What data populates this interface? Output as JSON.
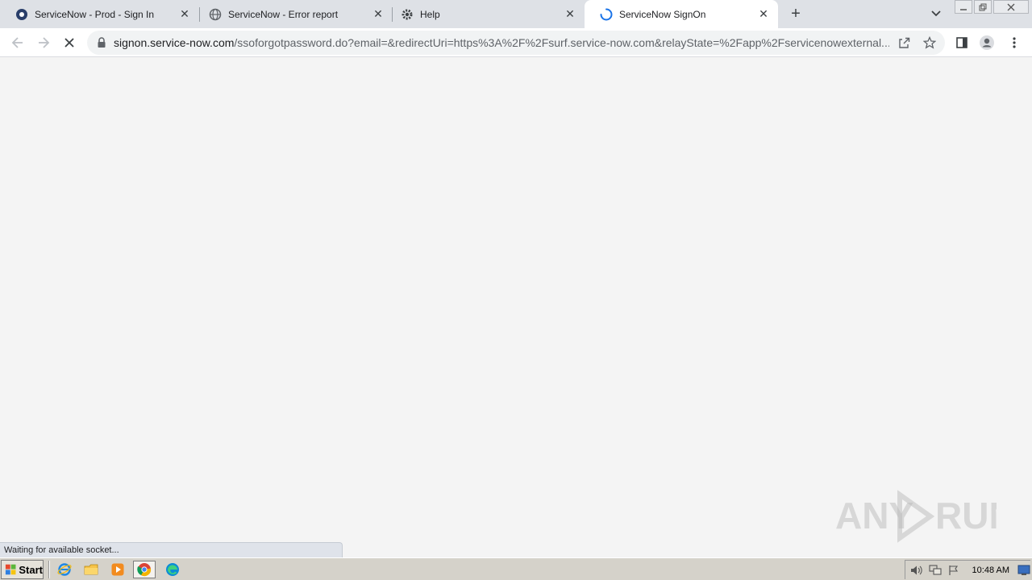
{
  "browser": {
    "tabs": [
      {
        "title": "ServiceNow - Prod - Sign In",
        "favicon": "servicenow-logo-icon",
        "active": false
      },
      {
        "title": "ServiceNow - Error report",
        "favicon": "globe-icon",
        "active": false
      },
      {
        "title": "Help",
        "favicon": "gear-icon",
        "active": false
      },
      {
        "title": "ServiceNow SignOn",
        "favicon": "loading-spinner-icon",
        "active": true
      }
    ],
    "address_bar": {
      "host": "signon.service-now.com",
      "path": "/ssoforgotpassword.do?email=&redirectUri=https%3A%2F%2Fsurf.service-now.com&relayState=%2Fapp%2Fservicenowexternal..."
    },
    "status_text": "Waiting for available socket..."
  },
  "watermark": {
    "text": "ANY RUN"
  },
  "taskbar": {
    "start_label": "Start",
    "apps": [
      "internet-explorer-icon",
      "file-explorer-icon",
      "media-player-icon",
      "chrome-icon",
      "edge-icon"
    ],
    "clock": "10:48 AM"
  },
  "colors": {
    "tabstrip": "#dee1e6",
    "content_bg": "#f4f4f4",
    "spinner": "#1a73e8",
    "servicenow_blue": "#293e6a"
  }
}
